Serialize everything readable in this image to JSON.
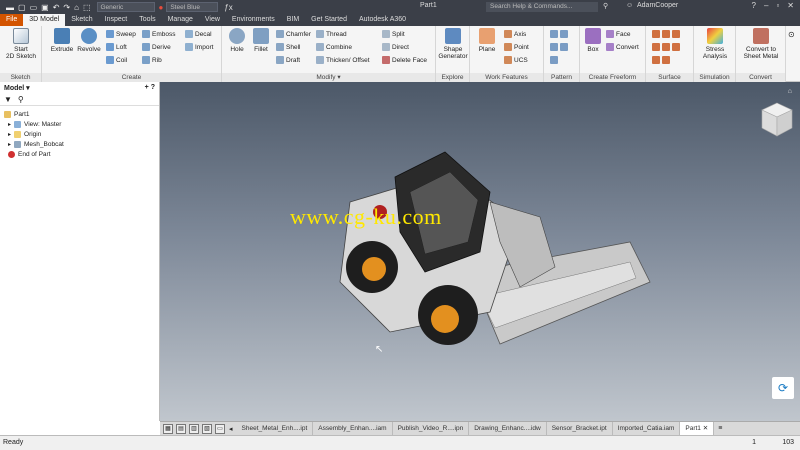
{
  "titlebar": {
    "material": "Generic",
    "appearance": "Steel Blue",
    "doc_title": "Part1",
    "search_placeholder": "Search Help & Commands...",
    "user": "AdamCooper"
  },
  "tabs": [
    "File",
    "3D Model",
    "Sketch",
    "Inspect",
    "Tools",
    "Manage",
    "View",
    "Environments",
    "BIM",
    "Get Started",
    "Autodesk A360"
  ],
  "ribbon": {
    "sketch": {
      "start_line1": "Start",
      "start_line2": "2D Sketch",
      "title": "Sketch"
    },
    "create": {
      "extrude": "Extrude",
      "revolve": "Revolve",
      "sweep": "Sweep",
      "loft": "Loft",
      "coil": "Coil",
      "emboss": "Emboss",
      "derive": "Derive",
      "rib": "Rib",
      "decal": "Decal",
      "import": "Import",
      "title": "Create"
    },
    "modify": {
      "hole": "Hole",
      "fillet": "Fillet",
      "chamfer": "Chamfer",
      "shell": "Shell",
      "draft": "Draft",
      "thread": "Thread",
      "combine": "Combine",
      "thicken": "Thicken/ Offset",
      "split": "Split",
      "direct": "Direct",
      "delete_face": "Delete Face",
      "title": "Modify ▾"
    },
    "explore": {
      "shape_line1": "Shape",
      "shape_line2": "Generator",
      "title": "Explore"
    },
    "work": {
      "plane": "Plane",
      "axis": "Axis",
      "point": "Point",
      "ucs": "UCS",
      "title": "Work Features"
    },
    "pattern": {
      "title": "Pattern"
    },
    "freeform": {
      "box": "Box",
      "face": "Face",
      "convert": "Convert",
      "title": "Create Freeform"
    },
    "surface": {
      "title": "Surface"
    },
    "simulation": {
      "stress_line1": "Stress",
      "stress_line2": "Analysis",
      "title": "Simulation"
    },
    "convert": {
      "cts_line1": "Convert to",
      "cts_line2": "Sheet Metal",
      "title": "Convert"
    }
  },
  "browser": {
    "title": "Model ▾",
    "items": [
      {
        "label": "Part1"
      },
      {
        "label": "View: Master"
      },
      {
        "label": "Origin"
      },
      {
        "label": "Mesh_Bobcat"
      },
      {
        "label": "End of Part"
      }
    ]
  },
  "viewport": {
    "watermark": "www.cg-ku.com"
  },
  "doc_tabs": [
    "Sheet_Metal_Enh....ipt",
    "Assembly_Enhan....iam",
    "Publish_Video_R....ipn",
    "Drawing_Enhanc....idw",
    "Sensor_Bracket.ipt",
    "Imported_Catia.iam",
    "Part1"
  ],
  "status": {
    "left": "Ready",
    "count1": "1",
    "count2": "103"
  },
  "colors": {
    "titlebar": "#3b3f48",
    "file_tab": "#d35400",
    "viewport_top": "#4c5868",
    "viewport_bottom": "#c0c6cd",
    "watermark": "#ffe800"
  }
}
